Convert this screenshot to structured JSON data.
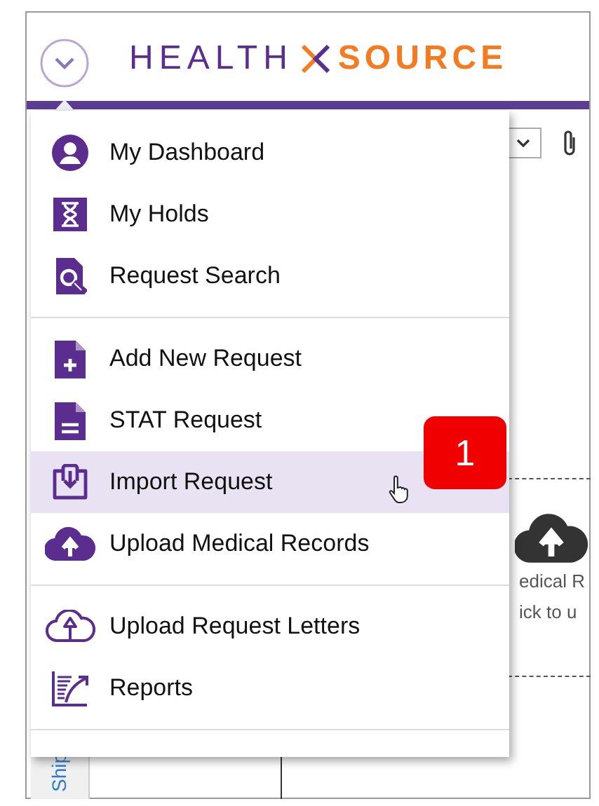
{
  "header": {
    "logo": {
      "left": "HEALTH",
      "right": "SOURCE"
    }
  },
  "background": {
    "upload_zone": {
      "lines": [
        "edical R",
        "ick to u"
      ]
    },
    "side_tab": "Ship"
  },
  "menu": {
    "groups": [
      {
        "items": [
          {
            "label": "My Dashboard",
            "kind": "user",
            "selected": false
          },
          {
            "label": "My Holds",
            "kind": "hourglass",
            "selected": false
          },
          {
            "label": "Request Search",
            "kind": "search",
            "selected": false
          }
        ]
      },
      {
        "items": [
          {
            "label": "Add New Request",
            "kind": "add",
            "selected": false
          },
          {
            "label": "STAT Request",
            "kind": "stat",
            "selected": false
          },
          {
            "label": "Import Request",
            "kind": "import",
            "selected": true
          },
          {
            "label": "Upload Medical Records",
            "kind": "upload",
            "selected": false
          }
        ]
      },
      {
        "items": [
          {
            "label": "Upload Request Letters",
            "kind": "letters",
            "selected": false
          },
          {
            "label": "Reports",
            "kind": "reports",
            "selected": false
          }
        ]
      }
    ]
  },
  "callout": {
    "number": "1"
  }
}
